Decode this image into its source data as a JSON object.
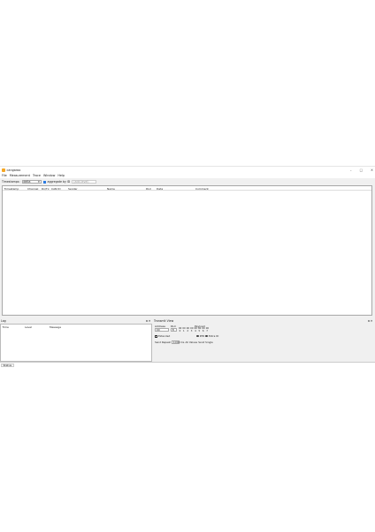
{
  "window": {
    "title": "cangaroo",
    "controls": {
      "minimize": "–",
      "maximize": "□",
      "close": "✕"
    }
  },
  "menu": [
    "File",
    "Measurement",
    "Trace",
    "Window",
    "Help"
  ],
  "toolbar": {
    "timestamps_label": "Timestamps:",
    "timestamps_value": "delta",
    "aggregate_label": "aggregate by ID",
    "aggregate_checked": true,
    "filter_placeholder": "(add-level)"
  },
  "trace": {
    "columns": [
      "Timestamp",
      "Channel",
      "Rx/Tx",
      "CAN ID",
      "Sender",
      "Name",
      "DLC",
      "Data",
      "Comment"
    ]
  },
  "log": {
    "title": "Log",
    "columns": [
      "Time",
      "Level",
      "Message"
    ]
  },
  "transmit": {
    "title": "Transmit View",
    "address_label": "Address",
    "dlc_label": "DLC",
    "address_value": "00",
    "dlc_value": "8",
    "payload_label": "Payload",
    "byte_rows": [
      [
        "00",
        "00",
        "00",
        "00",
        "00",
        "00",
        "00",
        "00"
      ],
      [
        "0",
        "1",
        "2",
        "3",
        "4",
        "5",
        "6",
        "7"
      ]
    ],
    "extended_label": "Extended",
    "rtr_label": "RTR",
    "extra_label": "Extra ID",
    "send_label": "Send Repeat",
    "send_value": "1000",
    "ms_label": "ms",
    "all_values_label": "All Values",
    "send_single_label": "Send Single"
  },
  "status": {
    "tab": "Status"
  }
}
